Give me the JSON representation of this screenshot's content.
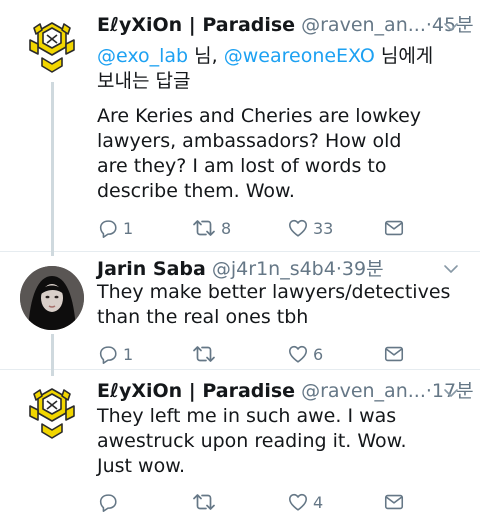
{
  "tweets": [
    {
      "name": "EℓyXiOn | Paradise",
      "handle": "@raven_an...",
      "sep": "·",
      "time": "45분",
      "reply_mention_1": "@exo_lab",
      "reply_mid": " 님, ",
      "reply_mention_2": "@weareoneEXO",
      "reply_end": " 님에게 보내는 답글",
      "text": "Are Keries and Cheries are lowkey lawyers, ambassadors? How old are they? I am lost of words to describe them. Wow.",
      "reply_count": "1",
      "retweet_count": "8",
      "like_count": "33",
      "avatar_icon": "exo-logo-icon"
    },
    {
      "name": "Jarin Saba",
      "handle": "@j4r1n_s4b4",
      "sep": "·",
      "time": "39분",
      "text": "They make better lawyers/detectives than the real ones tbh",
      "reply_count": "1",
      "retweet_count": "",
      "like_count": "6",
      "avatar_icon": "profile-photo"
    },
    {
      "name": "EℓyXiOn | Paradise",
      "handle": "@raven_an...",
      "sep": "·",
      "time": "17분",
      "text": "They left me in such awe. I was awestruck upon reading it. Wow. Just wow.",
      "reply_count": "",
      "retweet_count": "",
      "like_count": "4",
      "avatar_icon": "exo-logo-icon"
    }
  ],
  "colors": {
    "link": "#1da1f2",
    "secondary": "#657786",
    "thread_line": "#cfd9de",
    "exo_yellow": "#f2d600"
  }
}
